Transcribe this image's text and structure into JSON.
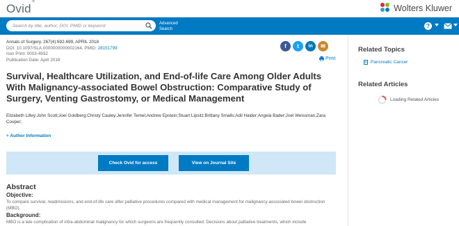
{
  "header": {
    "logo": "Ovid",
    "logo_mark": "®",
    "brand": "Wolters Kluwer",
    "brand_colors": [
      "#e5202e",
      "#85bc20",
      "#007ac3",
      "#409bd2"
    ]
  },
  "search": {
    "placeholder": "Search by title, author, DOI, PMID or keyword",
    "advanced_line1": "Advanced",
    "advanced_line2": "Search",
    "help_label": "?"
  },
  "article": {
    "citation": "Annals of Surgery. 267(4):692-699, APRIL 2018",
    "doi": "DOI: 10.1097/SLA.0000000000002164,",
    "pmid_label": "PMID:",
    "pmid": "28151799",
    "issn": "Issn Print: 0003-4932",
    "pub_date": "Publication Date: April 2018",
    "print_label": "Print",
    "title": "Survival, Healthcare Utilization, and End-of-life Care Among Older Adults With Malignancy-associated Bowel Obstruction: Comparative Study of Surgery, Venting Gastrostomy, or Medical Management",
    "authors": "Elizabeth Lilley;John Scott;Joel Goldberg;Christy Cauley;Jennifer Temel;Andrew Epstein;Stuart Lipsitz;Brittany Smalls;Adil Haider;Angela Bader;Joel Weissman;Zara Cooper;",
    "author_info": "+ Author Information"
  },
  "access": {
    "check_ovid": "Check Ovid for access",
    "view_journal": "View on Journal Site"
  },
  "abstract": {
    "heading": "Abstract",
    "objective_h": "Objective:",
    "objective": "To compare survival, readmissions, and end-of-life care after palliative procedures compared with medical management for malignancy-associated bowel obstruction (MBO).",
    "background_h": "Background:",
    "background": "MBO is a late complication of intra-abdominal malignancy for which surgeons are frequently consulted. Decisions about palliative treatments, which include"
  },
  "sidebar": {
    "related_topics": "Related Topics",
    "topic_1": "Pancreatic Cancer",
    "related_articles": "Related Articles",
    "loading": "Loading Related Articles"
  },
  "share": {
    "facebook": "f",
    "twitter": "t",
    "linkedin": "in",
    "email": "✉"
  },
  "colors": {
    "primary": "#007ac3",
    "band": "#cfe7f6",
    "facebook": "#3b5998",
    "twitter": "#1da1f2",
    "linkedin": "#0077b5",
    "email": "#c98a2c"
  }
}
